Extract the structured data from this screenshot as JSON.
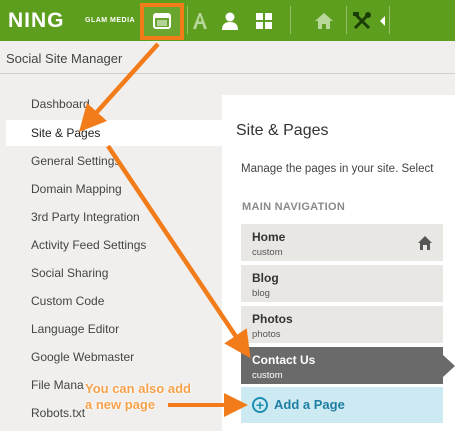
{
  "topbar": {
    "logo": "NING",
    "logo_sub": "GLAM MEDIA",
    "icons": [
      "window-icon",
      "font-icon",
      "user-icon",
      "grid-icon",
      "home-icon",
      "tools-icon",
      "arrow-left-icon"
    ]
  },
  "header": {
    "title": "Social Site Manager"
  },
  "sidebar": {
    "items": [
      {
        "label": "Dashboard"
      },
      {
        "label": "Site & Pages"
      },
      {
        "label": "General Settings"
      },
      {
        "label": "Domain Mapping"
      },
      {
        "label": "3rd Party Integration"
      },
      {
        "label": "Activity Feed Settings"
      },
      {
        "label": "Social Sharing"
      },
      {
        "label": "Custom Code"
      },
      {
        "label": "Language Editor"
      },
      {
        "label": "Google Webmaster"
      },
      {
        "label": "File Mana"
      },
      {
        "label": "Robots.txt"
      }
    ]
  },
  "main": {
    "title": "Site & Pages",
    "description": "Manage the pages in your site. Select",
    "section_label": "MAIN NAVIGATION",
    "pages": [
      {
        "name": "Home",
        "type": "custom"
      },
      {
        "name": "Blog",
        "type": "blog"
      },
      {
        "name": "Photos",
        "type": "photos"
      },
      {
        "name": "Contact Us",
        "type": "custom"
      }
    ],
    "add_page": "Add a Page"
  },
  "annotation": {
    "line1": "You can also add",
    "line2": "a new page"
  },
  "colors": {
    "brand_green": "#5e9e1e",
    "annotation_orange": "#f27b1a",
    "active_row": "#6a6a6a",
    "add_page_bg": "#cdeaf2"
  }
}
